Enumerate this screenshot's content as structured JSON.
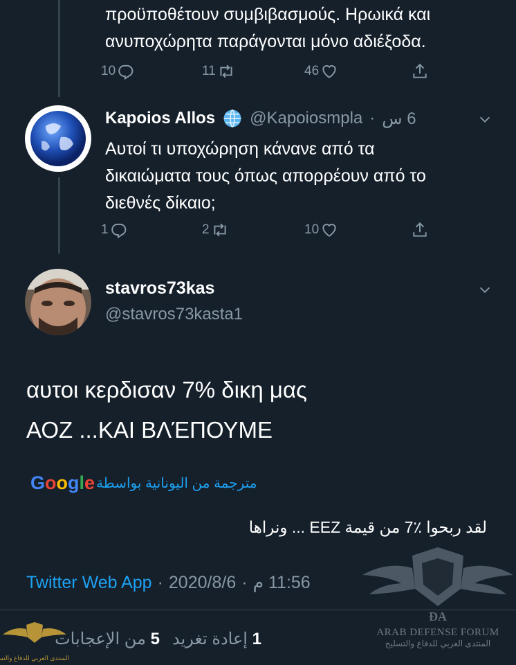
{
  "prev_tweet": {
    "text_line1": "προϋποθέτουν συμβιβασμούς. Ηρωικά και",
    "text_line2": "ανυποχώρητα παράγονται μόνο αδιέξοδα.",
    "replies": "10",
    "retweets": "11",
    "likes": "46"
  },
  "reply_tweet": {
    "name": "Kapoios Allos",
    "handle": "@Kapoiosmpla",
    "separator": "·",
    "time": "6 س",
    "text_line1": "Αυτοί τι υποχώρηση κάνανε από τα",
    "text_line2": "δικαιώματα τους όπως απορρέουν από το",
    "text_line3": "διεθνές δίκαιο;",
    "replies": "1",
    "retweets": "2",
    "likes": "10"
  },
  "main_tweet": {
    "name": "stavros73kas",
    "handle": "@stavros73kasta1",
    "text_line1": "αυτοι κερδισαν 7% δικη μας",
    "text_line2": "ΑΟΖ ...ΚΑΙ ΒΛΈΠΟΥΜΕ",
    "translated_by": "مترجمة من اليونانية بواسطة",
    "google": "Google",
    "translation": "لقد ربحوا ٪7 من قيمة EEZ ... ونراها",
    "source": "Twitter Web App",
    "meta_sep1": "·",
    "date": "2020/8/6",
    "meta_sep2": "·",
    "time": "11:56 م",
    "likes_count": "5",
    "likes_label": "من الإعجابات",
    "retweets_count": "1",
    "retweets_label": "إعادة تغريد"
  },
  "watermark": {
    "line1": "ARAB DEFENSE FORUM",
    "line2": "المنتدى العربي للدفاع والتسليح",
    "small": "المنتدى العربي للدفاع والتسليح"
  },
  "colors": {
    "background": "#15202b",
    "muted": "#8899a6",
    "accent": "#1da1f2",
    "google_blue": "#4285f4",
    "google_red": "#ea4335",
    "google_yellow": "#fbbc05",
    "google_green": "#34a853"
  }
}
